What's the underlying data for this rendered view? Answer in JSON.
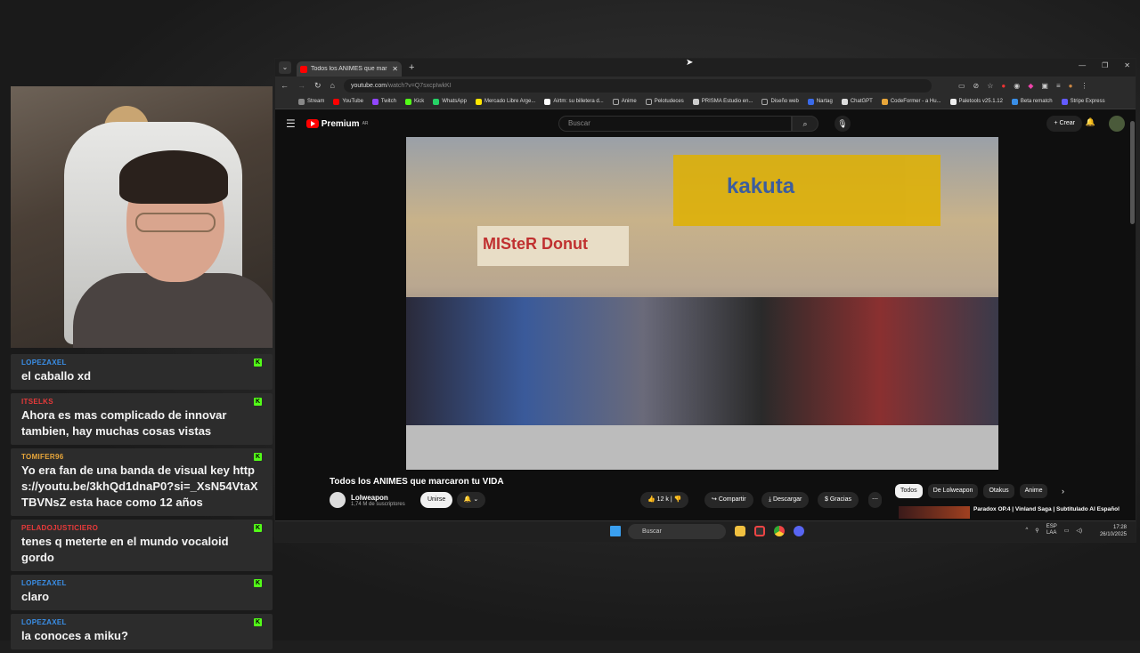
{
  "chat": [
    {
      "user": "LOPEZAXEL",
      "color": "#3a8fe8",
      "text": "el caballo xd"
    },
    {
      "user": "ITSELKS",
      "color": "#e83a3a",
      "text": "Ahora es mas complicado de innovar tambien, hay muchas cosas vistas"
    },
    {
      "user": "TOMIFER96",
      "color": "#e8a63a",
      "text": "Yo era fan de una banda de visual key https://youtu.be/3khQd1dnaP0?si=_XsN54VtaXTBVNsZ esta hace como 12 años"
    },
    {
      "user": "PELADOJUSTICIERO",
      "color": "#e83a3a",
      "text": "tenes q meterte en el mundo vocaloid gordo"
    },
    {
      "user": "LOPEZAXEL",
      "color": "#3a8fe8",
      "text": "claro"
    },
    {
      "user": "LOPEZAXEL",
      "color": "#3a8fe8",
      "text": "la conoces a miku?"
    }
  ],
  "browser": {
    "tab_title": "Todos los ANIMES que mar",
    "url_host": "youtube.com",
    "url_path": "/watch?v=Q7sxcpIwkKI",
    "bookmarks": [
      "Stream",
      "YouTube",
      "Twitch",
      "Kick",
      "WhatsApp",
      "Mercado Libre Arge...",
      "Airtm: su billetera d...",
      "Anime",
      "Pelotudeces",
      "PRISMA Estudio en...",
      "Diseño web",
      "Nartag",
      "ChatGPT",
      "CodeFormer - a Hu...",
      "Paletools v25.1.12",
      "Beta rematch",
      "Stripe Express"
    ]
  },
  "youtube": {
    "logo": "Premium",
    "logo_sup": "AR",
    "search_placeholder": "Buscar",
    "create": "+ Crear",
    "video_title": "Todos los ANIMES que marcaron tu VIDA",
    "channel": "Lolweapon",
    "subs": "1,74 M de suscriptores",
    "join": "Unirse",
    "likes": "12 k",
    "share": "Compartir",
    "download": "Descargar",
    "thanks": "Gracias",
    "chips": [
      "Todos",
      "De Lolweapon",
      "Otakus",
      "Anime"
    ],
    "rec_title": "Paradox OP.4 | Vinland Saga | Subtitulado Al Español",
    "sign_donut": "MISteR Donut",
    "sign_store": "kakuta"
  },
  "taskbar": {
    "search": "Buscar",
    "lang1": "ESP",
    "lang2": "LAA",
    "time": "17:28",
    "date": "26/10/2025"
  }
}
